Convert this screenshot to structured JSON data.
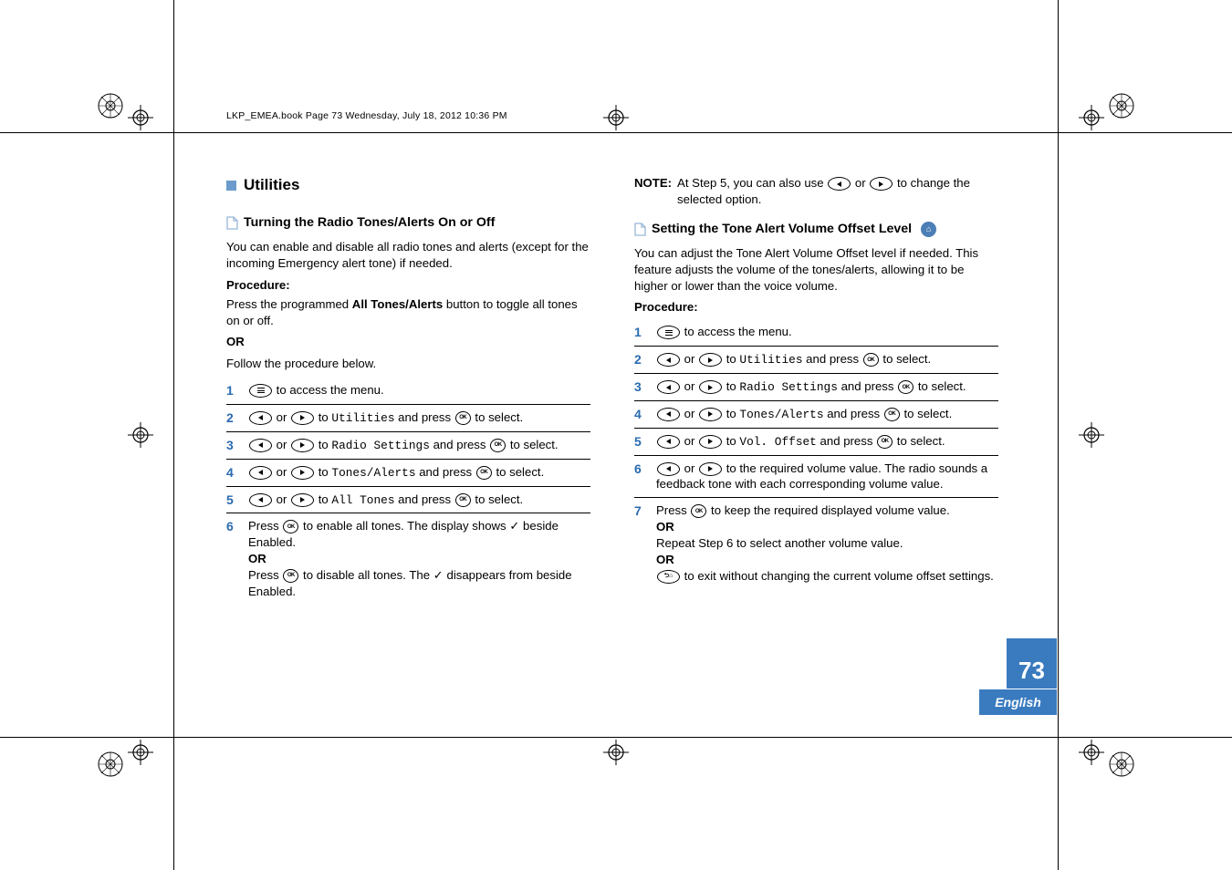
{
  "running_head": "LKP_EMEA.book  Page 73  Wednesday, July 18, 2012  10:36 PM",
  "section_title": "Utilities",
  "left": {
    "sub_title": "Turning the Radio Tones/Alerts On or Off",
    "intro": "You can enable and disable all radio tones and alerts (except for the incoming Emergency alert tone) if needed.",
    "procedure_label": "Procedure:",
    "press_text_a": "Press the programmed ",
    "press_text_bold": "All Tones/Alerts",
    "press_text_b": " button to toggle all tones on or off.",
    "or": "OR",
    "follow": "Follow the procedure below.",
    "steps": [
      {
        "n": "1",
        "pre": "",
        "post": " to access the menu."
      },
      {
        "n": "2",
        "pre": "",
        "mid1": " or ",
        "target": "Utilities",
        "mid2": " and press ",
        "post": " to select."
      },
      {
        "n": "3",
        "pre": "",
        "mid1": " or ",
        "target": "Radio Settings",
        "mid2": " and press ",
        "post": " to select."
      },
      {
        "n": "4",
        "pre": "",
        "mid1": " or ",
        "target": "Tones/Alerts",
        "mid2": " and press ",
        "post": " to select."
      },
      {
        "n": "5",
        "pre": "",
        "mid1": " or ",
        "target": "All Tones",
        "mid2": " and press ",
        "post": " to select."
      }
    ],
    "step6_a": "Press ",
    "step6_b": " to enable all tones. The display shows ",
    "step6_c": " beside Enabled.",
    "step6_or": "OR",
    "step6_d": "Press ",
    "step6_e": " to disable all tones. The ",
    "step6_f": " disappears from beside Enabled.",
    "step6_n": "6"
  },
  "right": {
    "note_label": "NOTE:",
    "note_a": "At Step 5, you can also use ",
    "note_b": " or ",
    "note_c": " to change the selected option.",
    "sub_title": "Setting the Tone Alert Volume Offset Level",
    "intro": "You can adjust the Tone Alert Volume Offset level if needed. This feature adjusts the volume of the tones/alerts, allowing it to be higher or lower than the voice volume.",
    "procedure_label": "Procedure:",
    "steps": [
      {
        "n": "1",
        "post": " to access the menu."
      },
      {
        "n": "2",
        "mid1": " or ",
        "target": "Utilities",
        "mid2": " and press ",
        "post": " to select."
      },
      {
        "n": "3",
        "mid1": " or ",
        "target": "Radio Settings",
        "mid2": " and press ",
        "post": " to select."
      },
      {
        "n": "4",
        "mid1": " or ",
        "target": "Tones/Alerts",
        "mid2": " and press ",
        "post": " to select."
      },
      {
        "n": "5",
        "mid1": " or ",
        "target": "Vol. Offset",
        "mid2": " and press ",
        "post": " to select."
      }
    ],
    "step6_n": "6",
    "step6_mid1": " or ",
    "step6_text": " to the required volume value. The radio sounds a feedback tone with each corresponding volume value.",
    "step7_n": "7",
    "step7_a": "Press ",
    "step7_b": " to keep the required displayed volume value.",
    "step7_or1": "OR",
    "step7_c": "Repeat Step 6 to select another volume value.",
    "step7_or2": "OR",
    "step7_d": " to exit without changing the current volume offset settings."
  },
  "page_number": "73",
  "lang_tab": "English",
  "labels": {
    "to": " to "
  }
}
